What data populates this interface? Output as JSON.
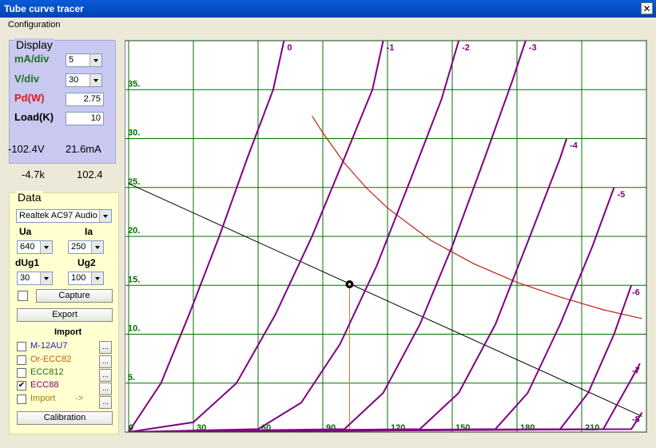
{
  "window": {
    "title": "Tube curve tracer"
  },
  "menu": {
    "configuration": "Configuration"
  },
  "display": {
    "header": "Display",
    "ma_div_label": "mA/div",
    "ma_div_value": "5",
    "v_div_label": "V/div",
    "v_div_value": "30",
    "pd_label": "Pd(W)",
    "pd_value": "2.75",
    "load_label": "Load(K)",
    "load_value": "10"
  },
  "readouts": {
    "voltage": "-102.4V",
    "current": "21.6mA",
    "resistance": "-4.7k",
    "value": "102.4"
  },
  "data": {
    "header": "Data",
    "device": "Realtek AC97 Audio",
    "ua_label": "Ua",
    "ua_value": "640",
    "ia_label": "Ia",
    "ia_value": "250",
    "dug1_label": "dUg1",
    "dug1_value": "30",
    "ug2_label": "Ug2",
    "ug2_value": "100",
    "capture_label": "Capture",
    "export_label": "Export",
    "import_header": "Import",
    "import_items": [
      {
        "label": "M-12AU7",
        "checked": false,
        "color": "#2020c0"
      },
      {
        "label": "Or-ECC82",
        "checked": false,
        "color": "#c06010"
      },
      {
        "label": "ECC812",
        "checked": false,
        "color": "#207020"
      },
      {
        "label": "ECC88",
        "checked": true,
        "color": "#800080"
      },
      {
        "label": "Import",
        "checked": false,
        "color": "#a08000"
      }
    ],
    "import_arrow": "->",
    "browse_label": "...",
    "calibration_label": "Calibration"
  },
  "chart_data": {
    "type": "line",
    "x_ticks": [
      "0",
      "30",
      "60",
      "90",
      "120",
      "150",
      "180",
      "210"
    ],
    "y_ticks": [
      "0",
      "5.",
      "10.",
      "15.",
      "20.",
      "25.",
      "30.",
      "35."
    ],
    "xlim": [
      0,
      240
    ],
    "ylim": [
      0,
      40
    ],
    "grid": true,
    "curve_labels": [
      "0",
      "-1",
      "-2",
      "-3",
      "-4",
      "-5",
      "-6",
      "-7",
      "-8"
    ],
    "series": [
      {
        "name": "0",
        "values": [
          [
            0,
            0
          ],
          [
            15,
            5
          ],
          [
            28,
            12
          ],
          [
            42,
            20
          ],
          [
            55,
            28
          ],
          [
            67,
            35
          ],
          [
            72,
            40
          ]
        ]
      },
      {
        "name": "-1",
        "values": [
          [
            0,
            0
          ],
          [
            30,
            1
          ],
          [
            50,
            5
          ],
          [
            68,
            12
          ],
          [
            85,
            20
          ],
          [
            100,
            28
          ],
          [
            113,
            35
          ],
          [
            118,
            40
          ]
        ]
      },
      {
        "name": "-2",
        "values": [
          [
            0,
            0
          ],
          [
            60,
            0.3
          ],
          [
            80,
            3
          ],
          [
            98,
            9
          ],
          [
            115,
            17
          ],
          [
            131,
            26
          ],
          [
            145,
            34
          ],
          [
            153,
            40
          ]
        ]
      },
      {
        "name": "-3",
        "values": [
          [
            0,
            0
          ],
          [
            100,
            0.3
          ],
          [
            118,
            4
          ],
          [
            135,
            11
          ],
          [
            150,
            19
          ],
          [
            165,
            28
          ],
          [
            178,
            36
          ],
          [
            184,
            40
          ]
        ]
      },
      {
        "name": "-4",
        "values": [
          [
            0,
            0
          ],
          [
            135,
            0.3
          ],
          [
            153,
            4
          ],
          [
            170,
            11
          ],
          [
            186,
            20
          ],
          [
            200,
            28
          ],
          [
            203,
            30
          ]
        ]
      },
      {
        "name": "-5",
        "values": [
          [
            0,
            0
          ],
          [
            170,
            0.3
          ],
          [
            185,
            4
          ],
          [
            200,
            11
          ],
          [
            215,
            19
          ],
          [
            225,
            25
          ]
        ]
      },
      {
        "name": "-6",
        "values": [
          [
            0,
            0
          ],
          [
            200,
            0.3
          ],
          [
            213,
            4
          ],
          [
            225,
            10
          ],
          [
            233,
            15
          ]
        ]
      },
      {
        "name": "-7",
        "values": [
          [
            0,
            0
          ],
          [
            220,
            0.3
          ],
          [
            232,
            5
          ],
          [
            237,
            7
          ]
        ]
      },
      {
        "name": "-8",
        "values": [
          [
            0,
            0
          ],
          [
            233,
            0.3
          ],
          [
            238,
            2
          ]
        ]
      }
    ],
    "dissipation_curve": [
      [
        85,
        32.3
      ],
      [
        90,
        30.6
      ],
      [
        100,
        27.5
      ],
      [
        110,
        25
      ],
      [
        120,
        22.9
      ],
      [
        140,
        19.6
      ],
      [
        160,
        17.2
      ],
      [
        180,
        15.3
      ],
      [
        200,
        13.8
      ],
      [
        220,
        12.5
      ],
      [
        238,
        11.6
      ]
    ],
    "load_line": [
      [
        0,
        25.4
      ],
      [
        238,
        1.6
      ]
    ],
    "operating_point": [
      102.4,
      15.1
    ]
  }
}
